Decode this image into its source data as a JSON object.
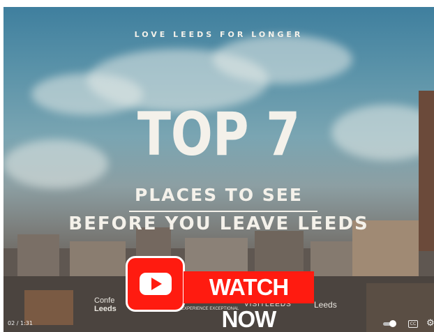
{
  "video": {
    "tagline": "LOVE LEEDS FOR LONGER",
    "headline": "TOP 7",
    "subline1": "PLACES TO SEE",
    "subline2": "BEFORE YOU LEAVE LEEDS",
    "logos": {
      "conference_line1": "Confe",
      "conference_line2": "Leeds",
      "leeds_line1": "Leeds",
      "leeds_line2": "EXPERIENCE EXCEPTIONAL",
      "visit": "VISITLEEDS",
      "leeds_crest": "Leeds"
    }
  },
  "watch_button": {
    "label": "WATCH NOW",
    "icon": "youtube-play-icon",
    "color": "#ff1b10"
  },
  "player": {
    "time": "02 / 1:31",
    "icons": [
      "autoplay-toggle-icon",
      "closed-captions-icon",
      "settings-gear-icon"
    ],
    "cc_label": "CC"
  }
}
